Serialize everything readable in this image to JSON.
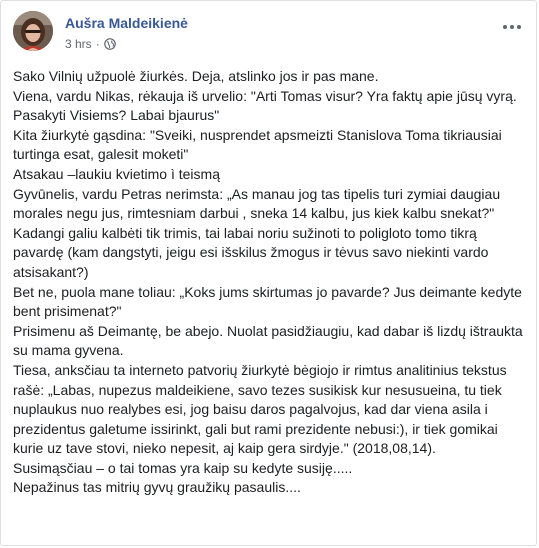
{
  "post": {
    "author": "Aušra Maldeikienė",
    "time": "3 hrs",
    "separator": "·",
    "privacy_icon": "globe-icon",
    "more_icon": "more-options-icon",
    "paragraphs": [
      "Sako Vilnių užpuolė žiurkės. Deja, atslinko jos ir pas mane.",
      "Viena, vardu Nikas, rėkauja iš urvelio: \"Arti Tomas visur? Yra faktų apie jūsų vyrą. Pasakyti Visiems? Labai bjaurus\"",
      "Kita žiurkytė gąsdina: \"Sveiki, nusprendet apsmeizti Stanislova Toma tikriausiai turtinga esat, galesit moketi\"",
      "Atsakau –laukiu kvietimo ì teismą",
      "Gyvūnelis, vardu Petras nerimsta: „As manau jog tas tipelis turi zymiai daugiau morales negu jus, rimtesniam darbui , sneka 14 kalbu, jus kiek kalbu snekat?\"",
      "Kadangi galiu kalbėti tik trimis, tai labai noriu sužinoti to poligloto tomo tikrą pavardę (kam dangstyti, jeigu esi išskilus žmogus ir tėvus savo niekinti vardo atsisakant?)",
      "Bet ne, puola mane toliau: „Koks jums skirtumas jo pavarde? Jus deimante kedyte bent prisimenat?\"",
      "Prisimenu aš Deimantę, be abejo. Nuolat pasidžiaugiu, kad dabar iš lizdų ištraukta su mama gyvena.",
      "Tiesa, anksčiau ta interneto patvorių žiurkytė bėgiojo ir rimtus analitinius tekstus rašė: „Labas, nupezus maldeikiene, savo tezes susikisk kur nesusueina, tu tiek nuplaukus nuo realybes esi, jog baisu daros pagalvojus, kad dar viena asila i prezidentus galetume issirinkt, gali but rami prezidente nebusi:), ir tiek gomikai kurie uz tave stovi, nieko nepesit, aj kaip gera sirdyje.\" (2018,08,14).",
      "Susimąsčiau – o tai tomas yra kaip su kedyte susiję.....",
      "Nepažinus tas mitrių gyvų graužikų pasaulis...."
    ]
  }
}
